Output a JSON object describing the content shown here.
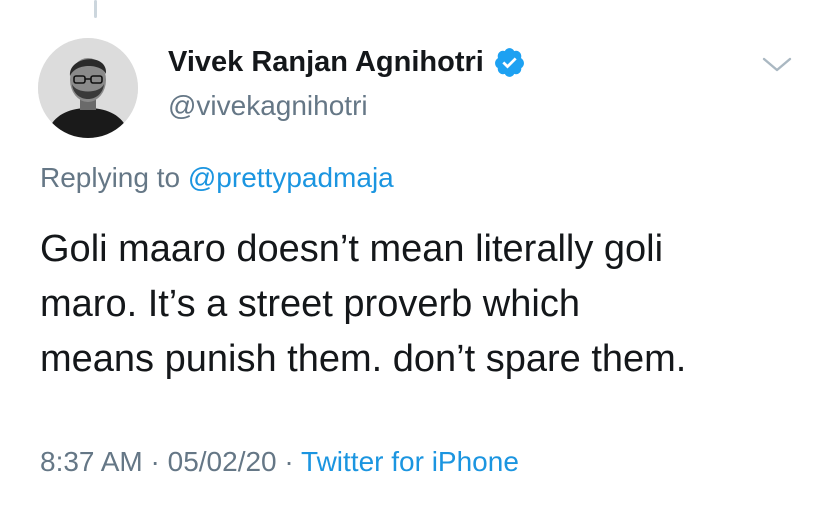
{
  "tweet": {
    "author": {
      "display_name": "Vivek Ranjan Agnihotri",
      "handle": "@vivekagnihotri",
      "verified": true
    },
    "replying_to": {
      "prefix": "Replying to",
      "mention": "@prettypadmaja"
    },
    "text_lines": [
      "Goli maaro doesn’t mean literally goli",
      "maro. It’s a street proverb which",
      "means punish them. don’t spare them."
    ],
    "meta": {
      "time": "8:37 AM",
      "separator": "·",
      "date": "05/02/20",
      "source": "Twitter for iPhone"
    }
  },
  "icons": {
    "verified": "verified-badge-icon",
    "menu": "chevron-down-icon",
    "avatar": "profile-photo"
  },
  "colors": {
    "text": "#14171a",
    "secondary": "#657786",
    "link": "#1b95e0",
    "verified": "#1da1f2",
    "thread_line": "#ccd6dd"
  }
}
